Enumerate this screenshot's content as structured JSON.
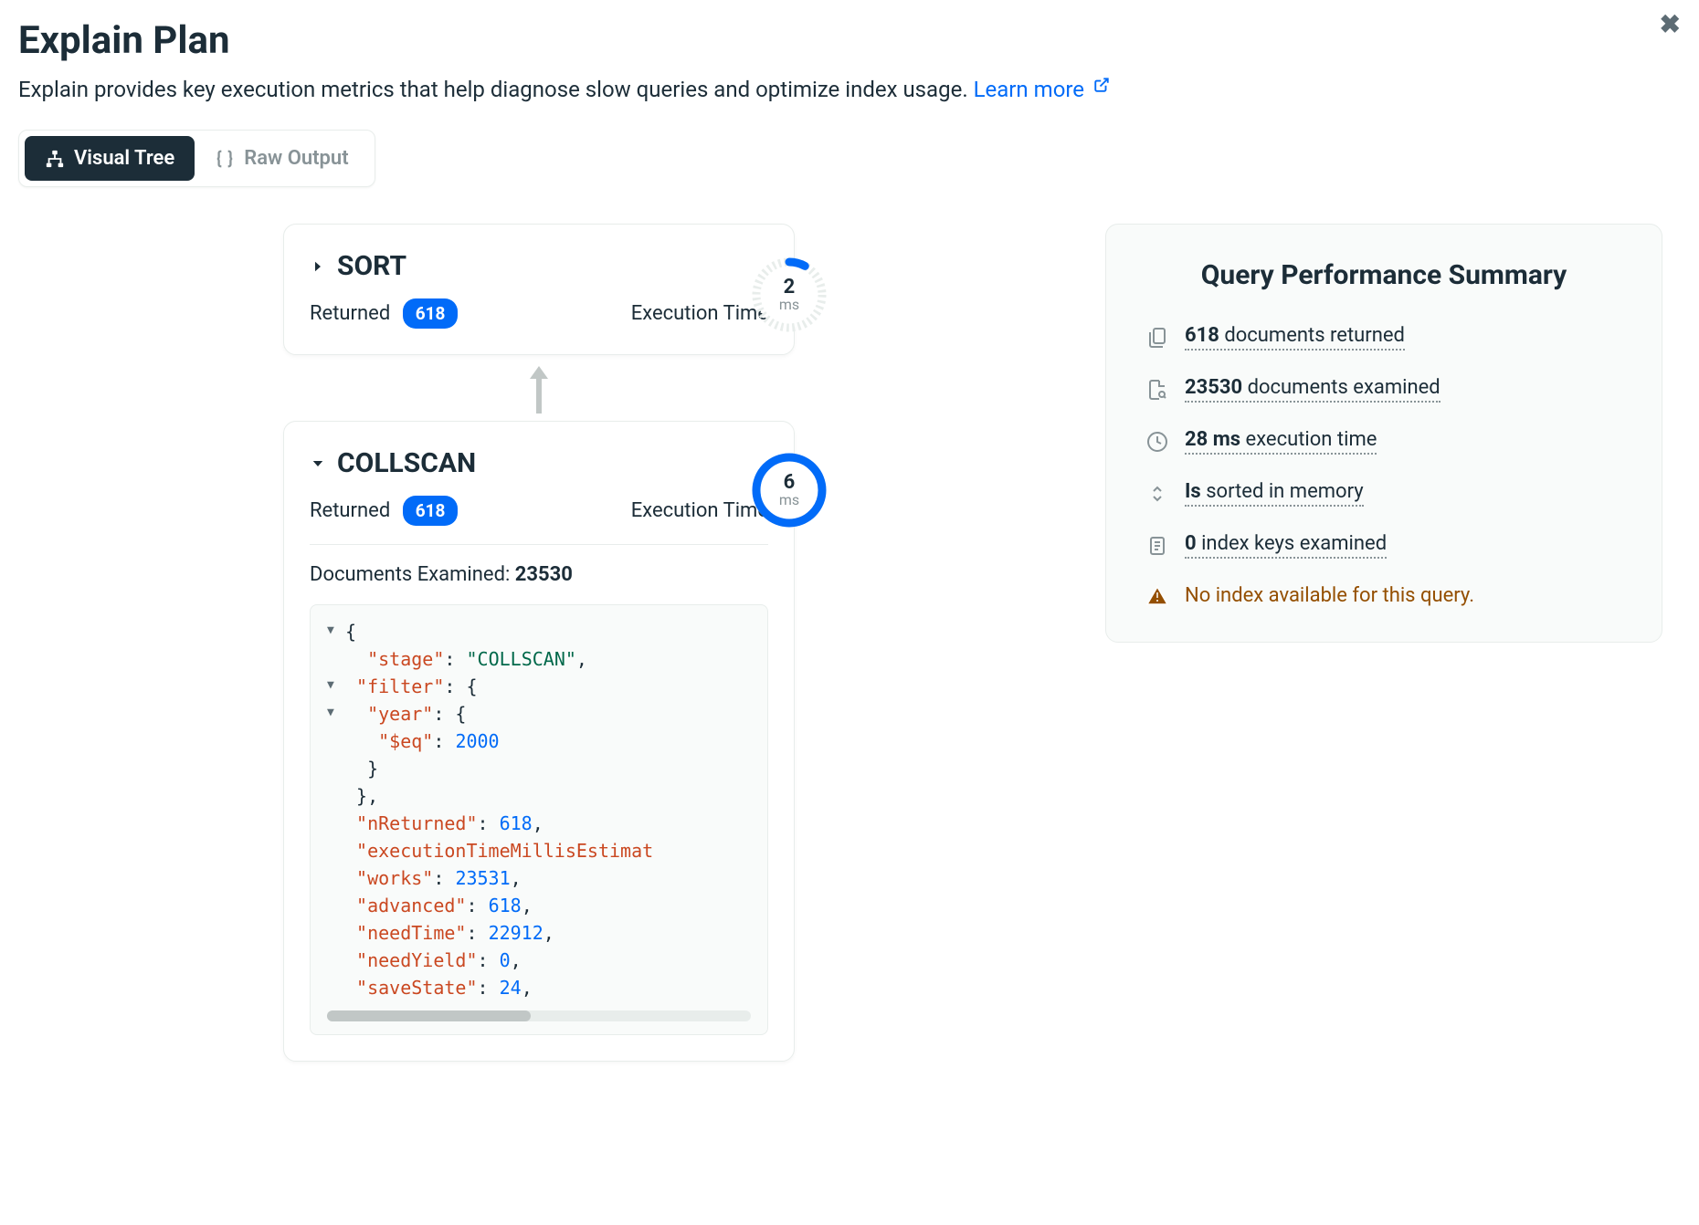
{
  "header": {
    "title": "Explain Plan",
    "subtitle": "Explain provides key execution metrics that help diagnose slow queries and optimize index usage. ",
    "learn_more": "Learn more"
  },
  "tabs": {
    "visual_tree": "Visual Tree",
    "raw_output": "Raw Output"
  },
  "stages": {
    "sort": {
      "name": "SORT",
      "returned_label": "Returned",
      "returned_count": "618",
      "exec_time_label": "Execution Time",
      "exec_time_value": "2",
      "exec_time_unit": "ms"
    },
    "collscan": {
      "name": "COLLSCAN",
      "returned_label": "Returned",
      "returned_count": "618",
      "exec_time_label": "Execution Time",
      "exec_time_value": "6",
      "exec_time_unit": "ms",
      "docs_examined_label": "Documents Examined: ",
      "docs_examined_value": "23530"
    }
  },
  "code": {
    "stage_key": "\"stage\"",
    "stage_val": "\"COLLSCAN\"",
    "filter_key": "\"filter\"",
    "year_key": "\"year\"",
    "eq_key": "\"$eq\"",
    "eq_val": "2000",
    "nReturned_key": "\"nReturned\"",
    "nReturned_val": "618",
    "execTime_key": "\"executionTimeMillisEstimat",
    "works_key": "\"works\"",
    "works_val": "23531",
    "advanced_key": "\"advanced\"",
    "advanced_val": "618",
    "needTime_key": "\"needTime\"",
    "needTime_val": "22912",
    "needYield_key": "\"needYield\"",
    "needYield_val": "0",
    "saveState_key": "\"saveState\"",
    "saveState_val": "24"
  },
  "summary": {
    "title": "Query Performance Summary",
    "docs_returned_bold": "618",
    "docs_returned_text": " documents returned",
    "docs_examined_bold": "23530",
    "docs_examined_text": " documents examined",
    "exec_time_bold": "28 ms",
    "exec_time_text": " execution time",
    "sorted_bold": "Is",
    "sorted_text": " sorted in memory",
    "index_keys_bold": "0",
    "index_keys_text": " index keys examined",
    "warning": "No index available for this query."
  }
}
